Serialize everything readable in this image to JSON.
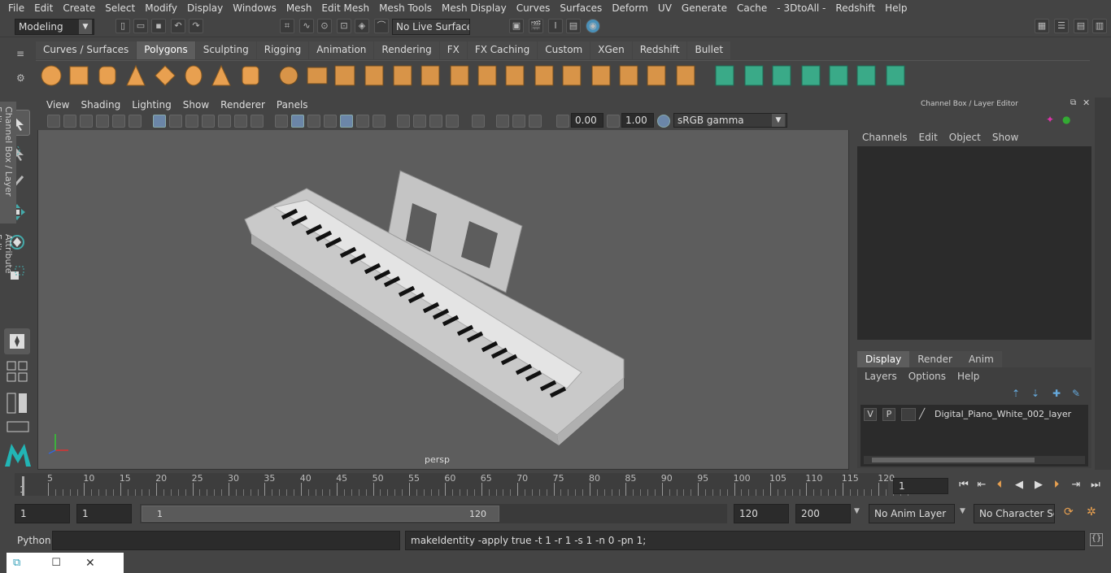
{
  "menu": [
    "File",
    "Edit",
    "Create",
    "Select",
    "Modify",
    "Display",
    "Windows",
    "Mesh",
    "Edit Mesh",
    "Mesh Tools",
    "Mesh Display",
    "Curves",
    "Surfaces",
    "Deform",
    "UV",
    "Generate",
    "Cache",
    "- 3DtoAll -",
    "Redshift",
    "Help"
  ],
  "status": {
    "mode": "Modeling",
    "live_surface": "No Live Surface"
  },
  "shelf_tabs": [
    "Curves / Surfaces",
    "Polygons",
    "Sculpting",
    "Rigging",
    "Animation",
    "Rendering",
    "FX",
    "FX Caching",
    "Custom",
    "XGen",
    "Redshift",
    "Bullet"
  ],
  "shelf_active": "Polygons",
  "viewport": {
    "menu": [
      "View",
      "Shading",
      "Lighting",
      "Show",
      "Renderer",
      "Panels"
    ],
    "exposure": "0.00",
    "gamma": "1.00",
    "colorspace": "sRGB gamma",
    "camera": "persp"
  },
  "channel_box": {
    "title": "Channel Box / Layer Editor",
    "menu": [
      "Channels",
      "Edit",
      "Object",
      "Show"
    ],
    "layer_tabs": [
      "Display",
      "Render",
      "Anim"
    ],
    "layer_menu": [
      "Layers",
      "Options",
      "Help"
    ],
    "layer": {
      "v": "V",
      "p": "P",
      "name": "Digital_Piano_White_002_layer"
    }
  },
  "side_tabs": [
    "Channel Box / Layer Editor",
    "Attribute Editor"
  ],
  "timeline": {
    "ticks": [
      "5",
      "10",
      "15",
      "20",
      "25",
      "30",
      "35",
      "40",
      "45",
      "50",
      "55",
      "60",
      "65",
      "70",
      "75",
      "80",
      "85",
      "90",
      "95",
      "100",
      "105",
      "110",
      "115",
      "120"
    ],
    "first_label": "1",
    "current_frame": "1"
  },
  "range": {
    "start": "1",
    "playback_start": "1",
    "slider_start": "1",
    "slider_end": "120",
    "end": "120",
    "anim_end": "200",
    "anim_layer": "No Anim Layer",
    "character_set": "No Character Set"
  },
  "cmd": {
    "lang": "Python",
    "output": "makeIdentity -apply true -t 1 -r 1 -s 1 -n 0 -pn 1;"
  }
}
